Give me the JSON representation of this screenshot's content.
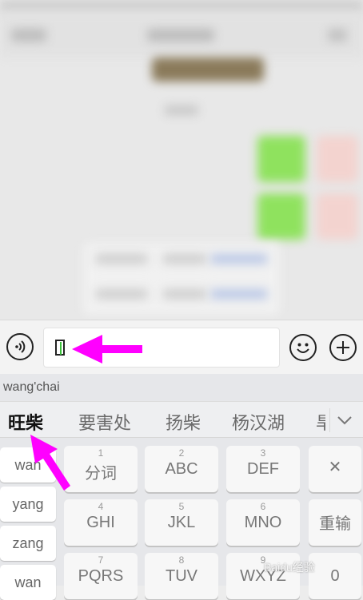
{
  "input": {
    "composing_text": ""
  },
  "keyboard": {
    "pinyin_display": "wang'chai",
    "candidates": [
      "旺柴",
      "要害处",
      "扬柴",
      "杨汉湖",
      "旱"
    ],
    "syllables": [
      "wan",
      "yang",
      "zang",
      "wan"
    ],
    "keys": [
      {
        "num": "1",
        "label": "分词"
      },
      {
        "num": "2",
        "label": "ABC"
      },
      {
        "num": "3",
        "label": "DEF"
      },
      {
        "num": "4",
        "label": "GHI"
      },
      {
        "num": "5",
        "label": "JKL"
      },
      {
        "num": "6",
        "label": "MNO"
      },
      {
        "num": "7",
        "label": "PQRS"
      },
      {
        "num": "8",
        "label": "TUV"
      },
      {
        "num": "9",
        "label": "WXYZ"
      }
    ],
    "delete_label": "✕",
    "reenter_label": "重输",
    "zero_label": "0"
  },
  "colors": {
    "annotation_arrow": "#ff00ff",
    "caret": "#3cc23c",
    "chat_bubble": "#8fe25e"
  },
  "watermark": "Baidu经验"
}
